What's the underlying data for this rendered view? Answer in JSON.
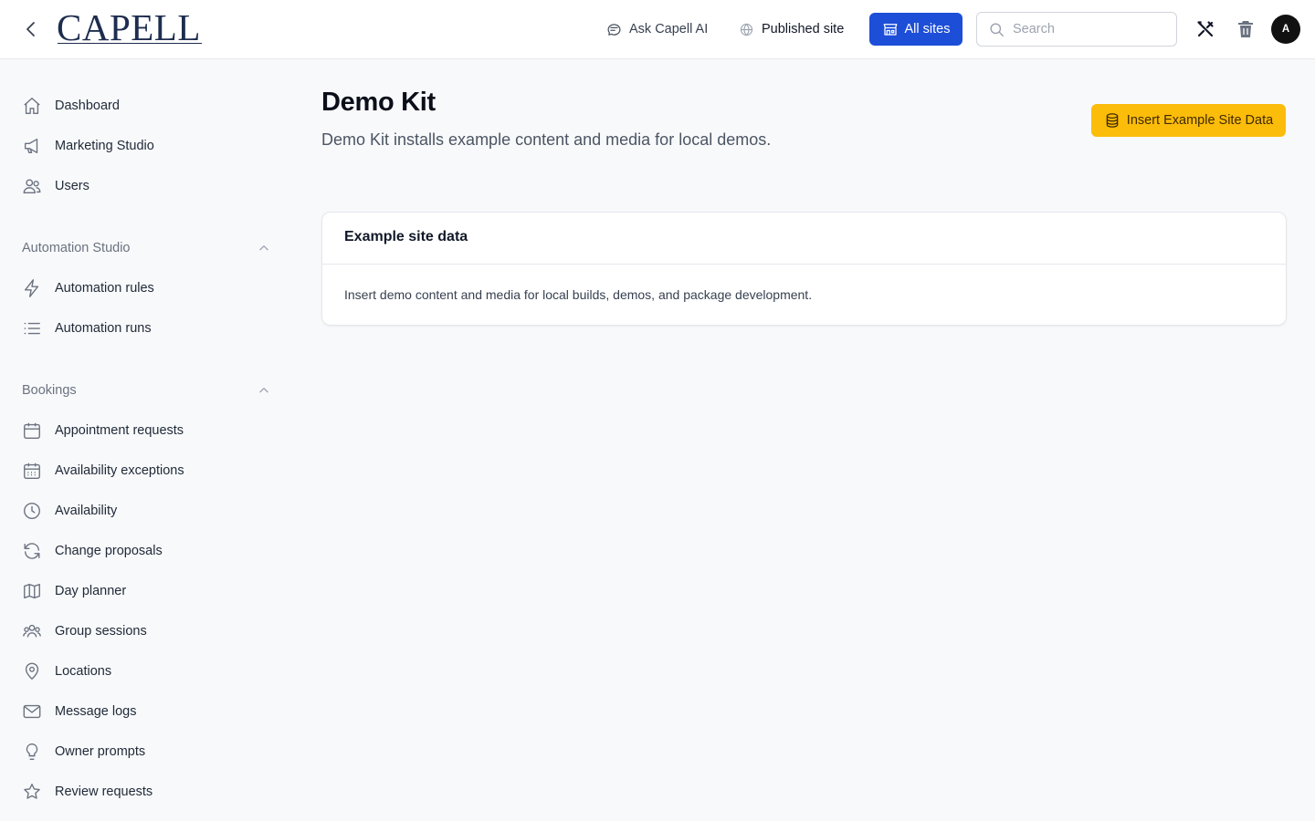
{
  "header": {
    "logo_text": "CAPELL",
    "ask_ai_label": "Ask Capell AI",
    "published_site_label": "Published site",
    "all_sites_label": "All sites",
    "search_placeholder": "Search",
    "avatar_initial": "A"
  },
  "sidebar": {
    "top_items": [
      {
        "label": "Dashboard",
        "icon": "home-icon"
      },
      {
        "label": "Marketing Studio",
        "icon": "megaphone-icon"
      },
      {
        "label": "Users",
        "icon": "users-icon"
      }
    ],
    "groups": [
      {
        "label": "Automation Studio",
        "expanded": true,
        "items": [
          {
            "label": "Automation rules",
            "icon": "bolt-icon"
          },
          {
            "label": "Automation runs",
            "icon": "list-icon"
          }
        ]
      },
      {
        "label": "Bookings",
        "expanded": true,
        "items": [
          {
            "label": "Appointment requests",
            "icon": "calendar-icon"
          },
          {
            "label": "Availability exceptions",
            "icon": "calendar-days-icon"
          },
          {
            "label": "Availability",
            "icon": "clock-icon"
          },
          {
            "label": "Change proposals",
            "icon": "refresh-icon"
          },
          {
            "label": "Day planner",
            "icon": "map-icon"
          },
          {
            "label": "Group sessions",
            "icon": "user-group-icon"
          },
          {
            "label": "Locations",
            "icon": "map-pin-icon"
          },
          {
            "label": "Message logs",
            "icon": "envelope-icon"
          },
          {
            "label": "Owner prompts",
            "icon": "light-bulb-icon"
          },
          {
            "label": "Review requests",
            "icon": "star-icon"
          }
        ]
      }
    ]
  },
  "main": {
    "title": "Demo Kit",
    "subtitle": "Demo Kit installs example content and media for local demos.",
    "insert_button_label": "Insert Example Site Data",
    "card": {
      "title": "Example site data",
      "body": "Insert demo content and media for local builds, demos, and package development."
    }
  },
  "colors": {
    "primary": "#1d4ed8",
    "accent": "#fbbc0a",
    "logo": "#1e2d4f",
    "background": "#f8f9fb"
  }
}
